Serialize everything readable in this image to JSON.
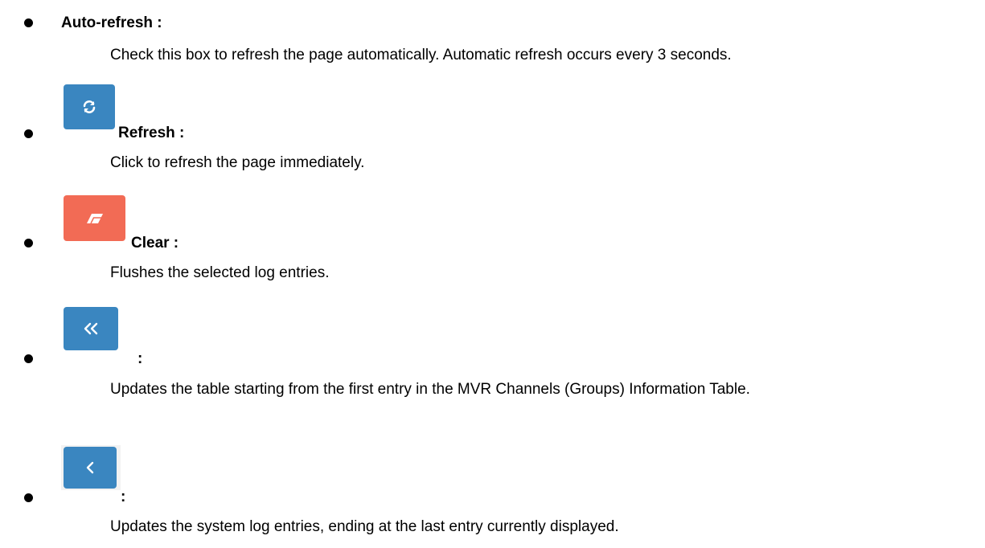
{
  "items": [
    {
      "label": "Auto-refresh :",
      "description": "Check this box to refresh the page automatically. Automatic refresh occurs every 3 seconds."
    },
    {
      "icon": "refresh-icon",
      "label": "Refresh :",
      "description": "Click to refresh the page immediately.",
      "color": "#3a86c0"
    },
    {
      "icon": "eraser-icon",
      "label": "Clear :",
      "description": "Flushes the selected log entries.",
      "color": "#f26b55"
    },
    {
      "icon": "double-chevron-left-icon",
      "label": ":",
      "description": "Updates the table starting from the first entry in the MVR Channels (Groups) Information Table.",
      "color": "#3a86c0"
    },
    {
      "icon": "chevron-left-icon",
      "label": ":",
      "description": "Updates the system log entries, ending at the last entry currently displayed.",
      "color": "#3a86c0"
    }
  ]
}
